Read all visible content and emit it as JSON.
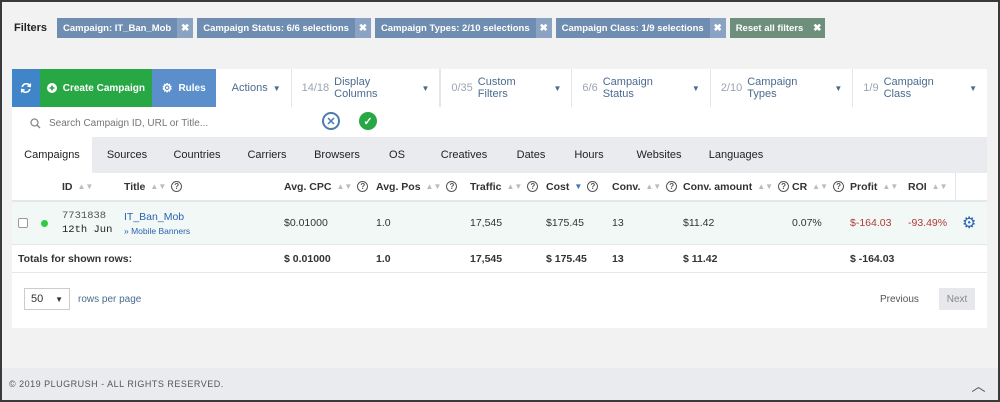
{
  "filters": {
    "label": "Filters",
    "chips": [
      {
        "text": "Campaign: IT_Ban_Mob"
      },
      {
        "text": "Campaign Status: 6/6 selections"
      },
      {
        "text": "Campaign Types: 2/10 selections"
      },
      {
        "text": "Campaign Class: 1/9 selections"
      }
    ],
    "reset": "Reset all filters",
    "close_glyph": "✖"
  },
  "toolbar": {
    "create_label": "Create Campaign",
    "rules_label": "Rules",
    "actions": "Actions",
    "display_count": "14/18",
    "display_label": "Display Columns",
    "custom_count": "0/35",
    "custom_label": "Custom Filters",
    "status_count": "6/6",
    "status_label": "Campaign Status",
    "types_count": "2/10",
    "types_label": "Campaign Types",
    "class_count": "1/9",
    "class_label": "Campaign Class"
  },
  "search": {
    "placeholder": "Search Campaign ID, URL or Title...",
    "value": ""
  },
  "tabs": [
    "Campaigns",
    "Sources",
    "Countries",
    "Carriers",
    "Browsers",
    "OS",
    "Creatives",
    "Dates",
    "Hours",
    "Websites",
    "Languages"
  ],
  "columns": {
    "id": "ID",
    "title": "Title",
    "avg_cpc": "Avg. CPC",
    "avg_pos": "Avg. Pos",
    "traffic": "Traffic",
    "cost": "Cost",
    "conv": "Conv.",
    "conv_amount": "Conv. amount",
    "cr": "CR",
    "profit": "Profit",
    "roi": "ROI"
  },
  "row": {
    "id": "7731838",
    "date": "12th Jun",
    "title": "IT_Ban_Mob",
    "subtitle": "» Mobile Banners",
    "avg_cpc": "$0.01000",
    "avg_pos": "1.0",
    "traffic": "17,545",
    "cost": "$175.45",
    "conv": "13",
    "conv_amount": "$11.42",
    "cr": "0.07%",
    "profit": "$-164.03",
    "roi": "-93.49%"
  },
  "totals": {
    "label": "Totals for shown rows:",
    "avg_cpc": "$ 0.01000",
    "avg_pos": "1.0",
    "traffic": "17,545",
    "cost": "$ 175.45",
    "conv": "13",
    "conv_amount": "$ 11.42",
    "profit": "$ -164.03"
  },
  "pager": {
    "per_page": "50",
    "rows_label": "rows per page",
    "prev": "Previous",
    "next": "Next"
  },
  "footer": {
    "text": "© 2019 PLUGRUSH - ALL RIGHTS RESERVED."
  },
  "colors": {
    "primary": "#3f85c7",
    "success": "#28a745",
    "chip": "#6f8db0",
    "negative": "#b03a3a"
  }
}
